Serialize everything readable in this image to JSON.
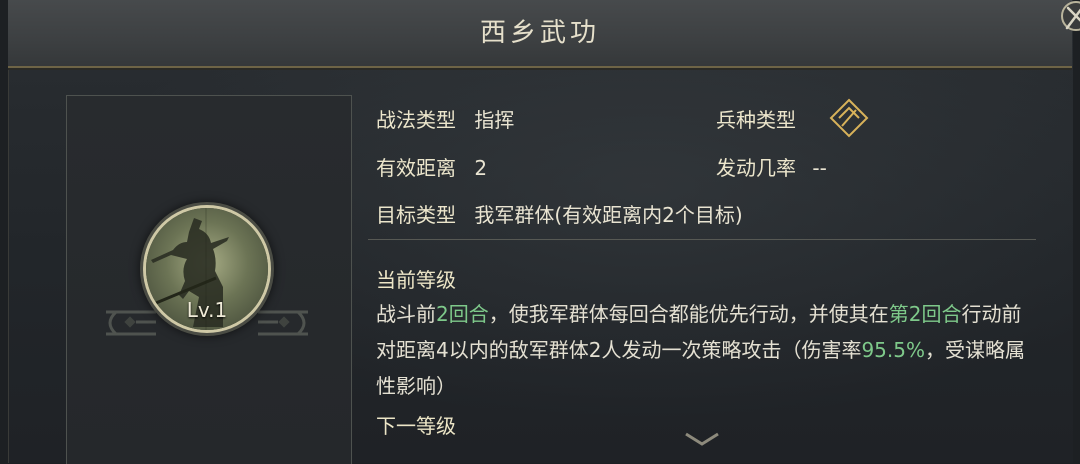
{
  "window": {
    "title": "西乡武功"
  },
  "skill": {
    "level": "Lv.1"
  },
  "stats": {
    "tactic_type_label": "战法类型",
    "tactic_type_value": "指挥",
    "range_label": "有效距离",
    "range_value": "2",
    "target_label": "目标类型",
    "target_value": "我军群体(有效距离内2个目标)",
    "troop_type_label": "兵种类型",
    "troop_type_icon": "troop-type-icon",
    "trigger_rate_label": "发动几率",
    "trigger_rate_value": "--"
  },
  "current_level": {
    "heading": "当前等级",
    "desc_1": "战斗前",
    "desc_2": "2回合",
    "desc_3": "，使我军群体每回合都能优先行动，并使其在",
    "desc_4": "第2回合",
    "desc_5": "行动前对距离4以内的敌军群体2人发动一次策略攻击（伤害率",
    "desc_6": "95.5%",
    "desc_7": "，受谋略属性影响）"
  },
  "next_level": {
    "heading": "下一等级"
  },
  "colors": {
    "highlight": "#7ec98a",
    "title_text": "#e6e0cb",
    "gold_accent": "#d8b25a"
  }
}
